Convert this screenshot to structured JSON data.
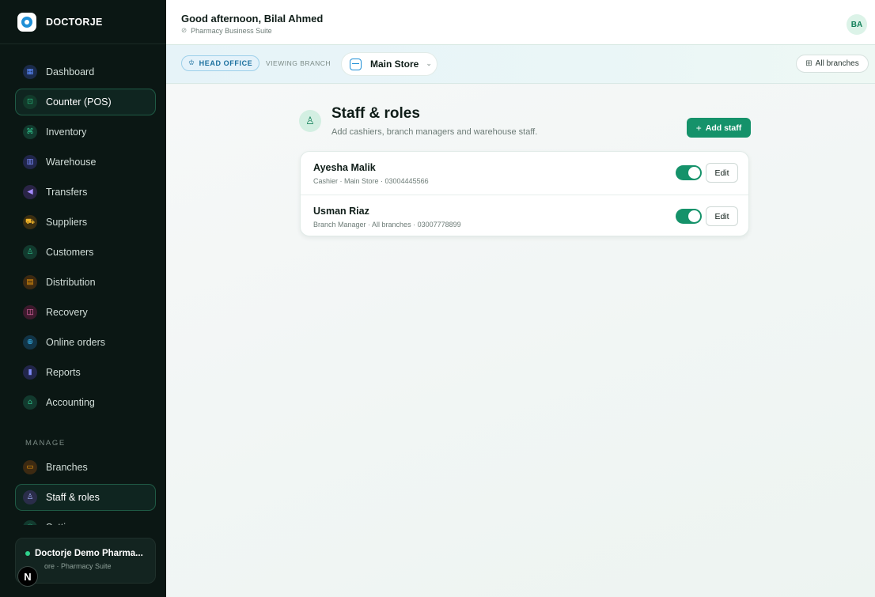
{
  "brand": {
    "name": "DOCTORJE"
  },
  "sidebar": {
    "items": [
      {
        "label": "Dashboard",
        "icon": "grid-icon",
        "glyph": "▦",
        "color": "#5b8cff",
        "bg": "#1b2b4a",
        "active": false
      },
      {
        "label": "Counter (POS)",
        "icon": "cart-icon",
        "glyph": "⊡",
        "color": "#27b57a",
        "bg": "#123a2b",
        "active": true
      },
      {
        "label": "Inventory",
        "icon": "boxes-icon",
        "glyph": "⌘",
        "color": "#2fbf8a",
        "bg": "#123a2e",
        "active": false
      },
      {
        "label": "Warehouse",
        "icon": "building-icon",
        "glyph": "▥",
        "color": "#7a8cff",
        "bg": "#21264a",
        "active": false
      },
      {
        "label": "Transfers",
        "icon": "send-icon",
        "glyph": "◀",
        "color": "#a58cff",
        "bg": "#2a2446",
        "active": false
      },
      {
        "label": "Suppliers",
        "icon": "truck-icon",
        "glyph": "⛟",
        "color": "#f0b429",
        "bg": "#3c2f12",
        "active": false
      },
      {
        "label": "Customers",
        "icon": "users-icon",
        "glyph": "♙",
        "color": "#2fbf8a",
        "bg": "#123a2e",
        "active": false
      },
      {
        "label": "Distribution",
        "icon": "briefcase-icon",
        "glyph": "▤",
        "color": "#f59e0b",
        "bg": "#3d2a12",
        "active": false
      },
      {
        "label": "Recovery",
        "icon": "wallet-icon",
        "glyph": "◫",
        "color": "#f472b6",
        "bg": "#3d1a2d",
        "active": false
      },
      {
        "label": "Online orders",
        "icon": "globe-icon",
        "glyph": "⊕",
        "color": "#38bdf8",
        "bg": "#123446",
        "active": false
      },
      {
        "label": "Reports",
        "icon": "bar-chart-icon",
        "glyph": "▮",
        "color": "#818cf8",
        "bg": "#22264a",
        "active": false
      },
      {
        "label": "Accounting",
        "icon": "bank-icon",
        "glyph": "⌂",
        "color": "#2fbf8a",
        "bg": "#123a2e",
        "active": false
      }
    ],
    "manage_label": "MANAGE",
    "manage_items": [
      {
        "label": "Branches",
        "icon": "store-icon",
        "glyph": "▭",
        "color": "#f59e0b",
        "bg": "#3d2a12",
        "active": false
      },
      {
        "label": "Staff & roles",
        "icon": "staff-icon",
        "glyph": "♙",
        "color": "#a5b4fc",
        "bg": "#2a2d4a",
        "active": true
      },
      {
        "label": "Settings",
        "icon": "settings-icon",
        "glyph": "✳",
        "color": "#2fbf8a",
        "bg": "#123a2e",
        "active": false
      }
    ],
    "org": {
      "name": "Doctorje Demo Pharma...",
      "sub": "ore · Pharmacy Suite"
    },
    "n_badge": "N"
  },
  "header": {
    "greeting": "Good afternoon, Bilal Ahmed",
    "suite": "Pharmacy Business Suite",
    "avatar_initials": "BA"
  },
  "branchbar": {
    "head_office": "HEAD OFFICE",
    "viewing_label": "VIEWING BRANCH",
    "selected_branch": "Main Store",
    "all_branches": "All branches"
  },
  "page": {
    "title": "Staff & roles",
    "subtitle": "Add cashiers, branch managers and warehouse staff.",
    "add_button": "Add staff"
  },
  "staff": [
    {
      "name": "Ayesha Malik",
      "meta": "Cashier · Main Store · 03004445566",
      "active": true,
      "edit_label": "Edit"
    },
    {
      "name": "Usman Riaz",
      "meta": "Branch Manager · All branches · 03007778899",
      "active": true,
      "edit_label": "Edit"
    }
  ],
  "colors": {
    "accent": "#15926a",
    "sidebar_bg": "#0b1714",
    "head_office_blue": "#1a6f9e"
  }
}
